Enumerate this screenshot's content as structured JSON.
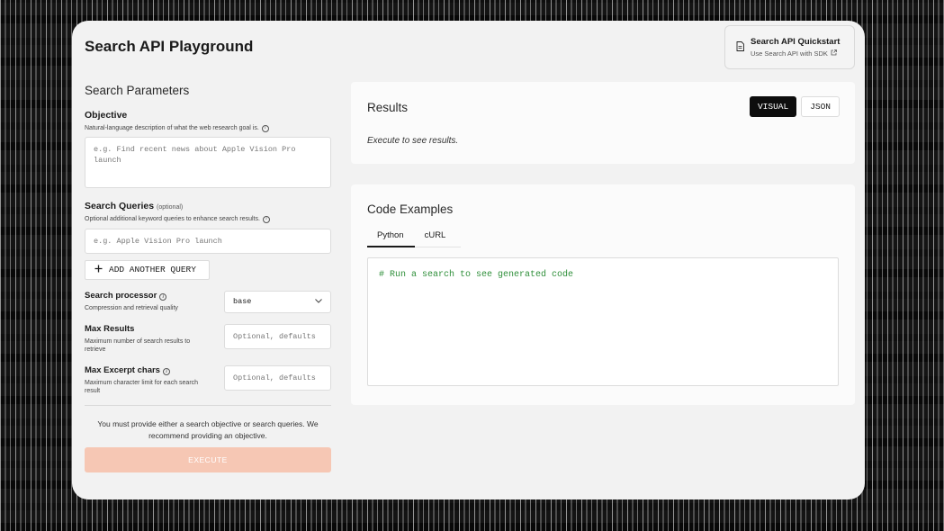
{
  "app": {
    "title": "Search API Playground"
  },
  "quickstart": {
    "title": "Search API Quickstart",
    "subtitle": "Use Search API with SDK"
  },
  "params": {
    "title": "Search Parameters",
    "objective": {
      "label": "Objective",
      "help": "Natural-language description of what the web research goal is.",
      "placeholder": "e.g. Find recent news about Apple Vision Pro launch"
    },
    "queries": {
      "label": "Search Queries",
      "optional": "(optional)",
      "help": "Optional additional keyword queries to enhance search results.",
      "placeholder": "e.g. Apple Vision Pro launch",
      "add_label": "ADD ANOTHER QUERY"
    },
    "processor": {
      "label": "Search processor",
      "help": "Compression and retrieval quality",
      "value": "base"
    },
    "max_results": {
      "label": "Max Results",
      "help": "Maximum number of search results to retrieve",
      "placeholder": "Optional, defaults"
    },
    "max_excerpt": {
      "label": "Max Excerpt chars",
      "help": "Maximum character limit for each search result",
      "placeholder": "Optional, defaults"
    },
    "hint": "You must provide either a search objective or search queries. We recommend providing an objective.",
    "execute_label": "EXECUTE"
  },
  "results": {
    "title": "Results",
    "toggle": {
      "visual": "VISUAL",
      "json": "JSON",
      "selected": "VISUAL"
    },
    "empty": "Execute to see results."
  },
  "code": {
    "title": "Code Examples",
    "tabs": [
      "Python",
      "cURL"
    ],
    "active_tab": "Python",
    "content": "# Run a search to see generated code"
  },
  "colors": {
    "accent": "#f6c7b4",
    "code_text": "#2f8f3a",
    "active_toggle": "#0d0d0d"
  }
}
